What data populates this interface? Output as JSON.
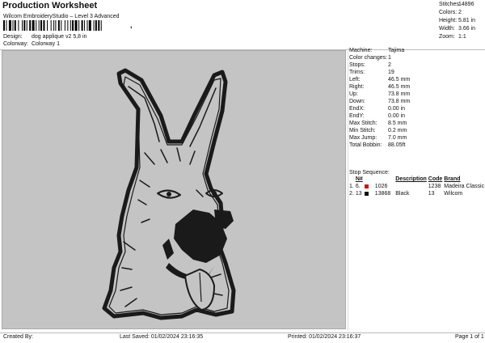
{
  "header": {
    "title": "Production Worksheet",
    "subtitle": "Wilcom EmbroideryStudio – Level 3 Advanced",
    "barcode_suffix": ","
  },
  "meta": {
    "design_label": "Design:",
    "design_value": "dog applique v2 5,8 in",
    "colorway_label": "Colorway:",
    "colorway_value": "Colorway 1"
  },
  "summary": [
    {
      "k": "Stitches:",
      "v": "14896"
    },
    {
      "k": "Colors:",
      "v": "2"
    },
    {
      "k": "Height:",
      "v": "5.81 in"
    },
    {
      "k": "Width:",
      "v": "3.66 in"
    },
    {
      "k": "Zoom:",
      "v": "1:1"
    }
  ],
  "details": [
    {
      "k": "Machine:",
      "v": "Tajima"
    },
    {
      "k": "Color changes:",
      "v": "1"
    },
    {
      "k": "Stops:",
      "v": "2"
    },
    {
      "k": "Trims:",
      "v": "19"
    },
    {
      "k": "Left:",
      "v": "46.5 mm"
    },
    {
      "k": "Right:",
      "v": "46.5 mm"
    },
    {
      "k": "Up:",
      "v": "73.8 mm"
    },
    {
      "k": "Down:",
      "v": "73.8 mm"
    },
    {
      "k": "EndX:",
      "v": "0.00 in"
    },
    {
      "k": "EndY:",
      "v": "0.00 in"
    },
    {
      "k": "Max Stitch:",
      "v": "8.5 mm"
    },
    {
      "k": "Min Stitch:",
      "v": "0.2 mm"
    },
    {
      "k": "Max Jump:",
      "v": "7.0 mm"
    },
    {
      "k": "Total Bobbin:",
      "v": "88.05ft"
    }
  ],
  "sequence": {
    "label": "Stop Sequence:",
    "columns": [
      "",
      "N#",
      "",
      "Description",
      "Code",
      "Brand"
    ],
    "rows": [
      {
        "idx": "1.",
        "n": "6.",
        "color": "#d01010",
        "stitches": "1026",
        "description": "",
        "code": "1238",
        "brand": "Madeira Classic 40"
      },
      {
        "idx": "2.",
        "n": "13",
        "color": "#111111",
        "stitches": "13868",
        "description": "Black",
        "code": "13",
        "brand": "Wilcom"
      }
    ]
  },
  "footer": {
    "created": "Created By:",
    "last_saved": "Last Saved: 01/02/2024 23:16:35",
    "printed": "Printed: 01/02/2024 23:16:37",
    "page": "Page 1 of 1"
  },
  "colors": {
    "canvas_bg": "#c4c4c4",
    "stitch_dark": "#1a1a1a"
  }
}
